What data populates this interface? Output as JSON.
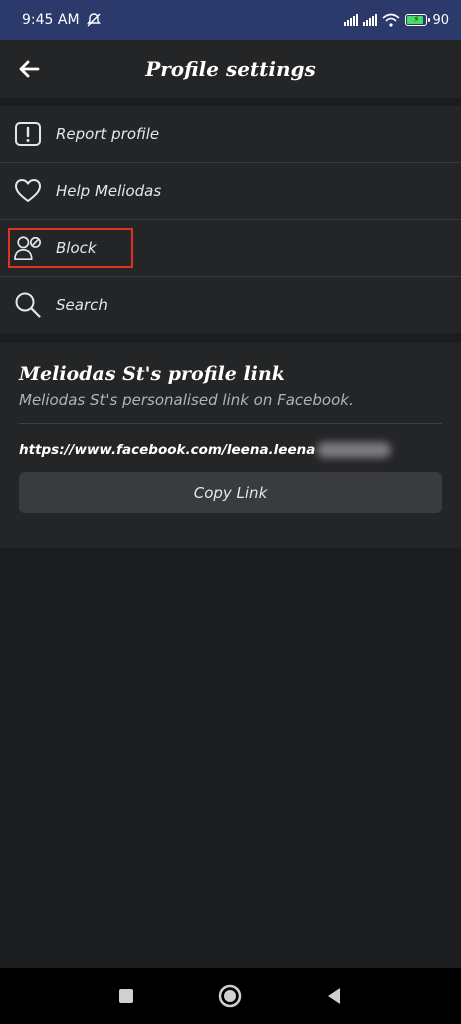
{
  "status_bar": {
    "time": "9:45 AM",
    "battery": "90",
    "icons": [
      "mute-icon",
      "signal-icon",
      "signal-icon",
      "wifi-icon",
      "battery-icon"
    ]
  },
  "header": {
    "title": "Profile settings",
    "back_icon": "arrow-left-icon"
  },
  "menu": {
    "items": [
      {
        "label": "Report profile",
        "icon": "report-icon"
      },
      {
        "label": "Help Meliodas",
        "icon": "heart-icon"
      },
      {
        "label": "Block",
        "icon": "block-user-icon"
      },
      {
        "label": "Search",
        "icon": "search-icon"
      }
    ]
  },
  "profile_link": {
    "title": "Meliodas St's profile link",
    "subtitle": "Meliodas St's personalised link on Facebook.",
    "url": "https://www.facebook.com/leena.leena",
    "copy_label": "Copy Link"
  },
  "nav_bar": {
    "icons": [
      "recents-icon",
      "home-icon",
      "back-icon"
    ]
  },
  "colors": {
    "status_bar": "#2b3a6b",
    "background": "#1c1d1f",
    "surface": "#242527",
    "button": "#3a3b3d",
    "highlight": "#e0321c"
  }
}
